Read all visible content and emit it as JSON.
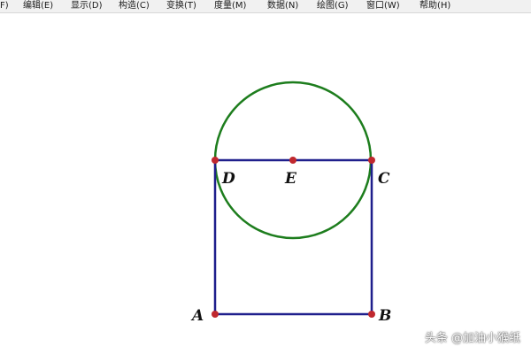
{
  "menubar": {
    "items": [
      "F)",
      "编辑(E)",
      "显示(D)",
      "构造(C)",
      "变换(T)",
      "度量(M)",
      "数据(N)",
      "绘图(G)",
      "窗口(W)",
      "帮助(H)"
    ]
  },
  "figure": {
    "points": {
      "A": "A",
      "B": "B",
      "C": "C",
      "D": "D",
      "E": "E"
    },
    "colors": {
      "square": "#1f1f8c",
      "circle": "#1d7d1d",
      "point": "#c0282e"
    }
  },
  "watermark": "头条 @加油小猴纸"
}
